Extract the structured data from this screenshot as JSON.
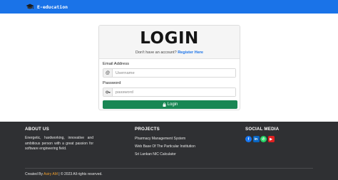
{
  "navbar": {
    "brand": "E-education",
    "brand_icon": "graduation-cap-icon",
    "background": "#1a73e8"
  },
  "login": {
    "title": "LOGIN",
    "no_account_text": "Don't have an account?",
    "register_link": "Register Here",
    "email_label": "Email Address",
    "email_icon": "at-icon",
    "email_placeholder": "Username",
    "password_label": "Password",
    "password_icon": "key-icon",
    "password_placeholder": "password",
    "button_icon": "lock-icon",
    "button_label": "Login",
    "button_color": "#198754"
  },
  "footer": {
    "about_heading": "ABOUT US",
    "about_text": "Energetic, hardworking, innovative and ambitious person with a great passion for software engineering field.",
    "projects_heading": "PROJECTS",
    "projects": [
      "Pharmacy Management System",
      "Web Base Of The Particular Institution",
      "Sri Lankan NIC Calculator"
    ],
    "social_heading": "SOCIAL MEDIA",
    "social": [
      {
        "name": "facebook-icon",
        "glyph": "f",
        "color": "#1877f2"
      },
      {
        "name": "linkedin-icon",
        "glyph": "in",
        "color": "#0a66c2"
      },
      {
        "name": "whatsapp-icon",
        "glyph": "✆",
        "color": "#25d366"
      },
      {
        "name": "youtube-icon",
        "glyph": "▶",
        "color": "#e02020"
      }
    ],
    "copyright_prefix": "Created By",
    "copyright_author": "Asiry AM",
    "copyright_suffix": "| © 2023 All rights reserved.",
    "background": "#2f3033"
  }
}
